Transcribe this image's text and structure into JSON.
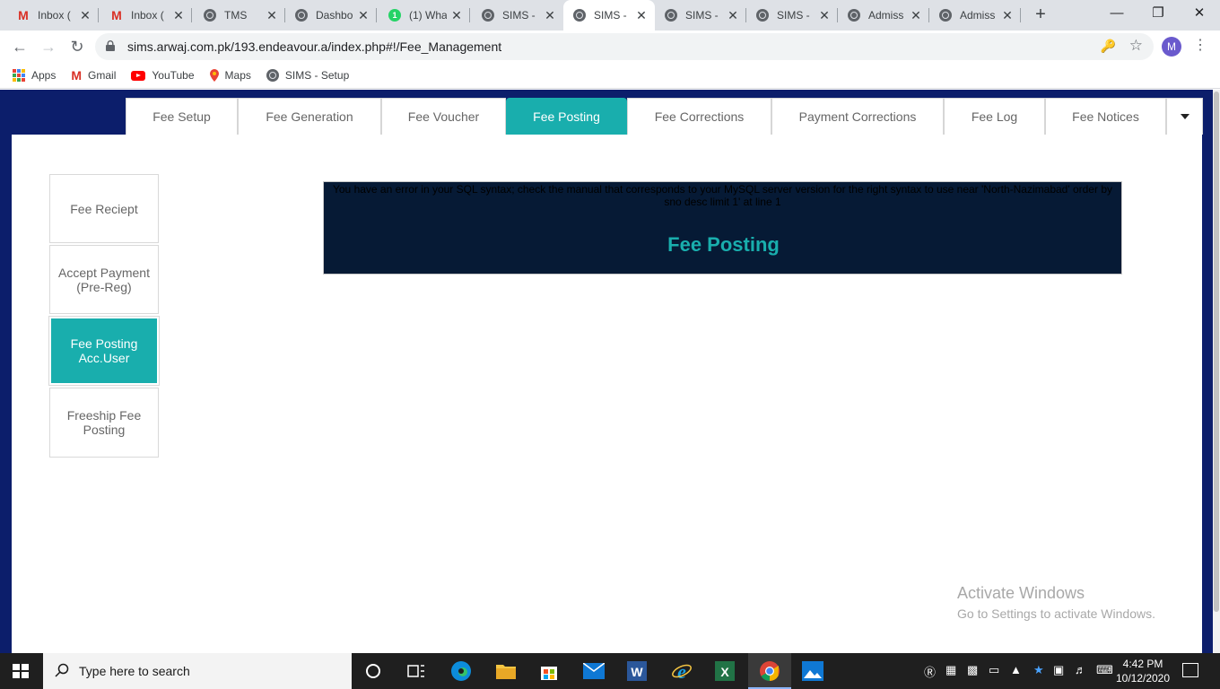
{
  "browser": {
    "tabs": [
      {
        "title": "Inbox (",
        "icon": "gmail-icon",
        "active": false
      },
      {
        "title": "Inbox (",
        "icon": "gmail-icon",
        "active": false
      },
      {
        "title": "TMS",
        "icon": "globe-icon",
        "active": false
      },
      {
        "title": "Dashbo",
        "icon": "globe-icon",
        "active": false
      },
      {
        "title": "(1) Wha",
        "icon": "whatsapp-icon",
        "active": false
      },
      {
        "title": "SIMS -",
        "icon": "globe-icon",
        "active": false
      },
      {
        "title": "SIMS -",
        "icon": "globe-icon",
        "active": true
      },
      {
        "title": "SIMS -",
        "icon": "globe-icon",
        "active": false
      },
      {
        "title": "SIMS -",
        "icon": "globe-icon",
        "active": false
      },
      {
        "title": "Admiss",
        "icon": "globe-icon",
        "active": false
      },
      {
        "title": "Admiss",
        "icon": "globe-icon",
        "active": false
      }
    ],
    "whatsapp_badge": "1",
    "url": "sims.arwaj.com.pk/193.endeavour.a/index.php#!/Fee_Management",
    "profile_initial": "M",
    "bookmarks": [
      {
        "label": "Apps",
        "icon": "apps-grid-icon"
      },
      {
        "label": "Gmail",
        "icon": "gmail-icon"
      },
      {
        "label": "YouTube",
        "icon": "youtube-icon"
      },
      {
        "label": "Maps",
        "icon": "maps-pin-icon"
      },
      {
        "label": "SIMS - Setup",
        "icon": "globe-icon"
      }
    ]
  },
  "fee_tabs": [
    {
      "label": "Fee Setup",
      "active": false
    },
    {
      "label": "Fee Generation",
      "active": false
    },
    {
      "label": "Fee Voucher",
      "active": false
    },
    {
      "label": "Fee Posting",
      "active": true
    },
    {
      "label": "Fee Corrections",
      "active": false
    },
    {
      "label": "Payment Corrections",
      "active": false
    },
    {
      "label": "Fee Log",
      "active": false
    },
    {
      "label": "Fee Notices",
      "active": false
    }
  ],
  "side_menu": [
    {
      "label": "Fee Reciept",
      "active": false
    },
    {
      "label": "Accept Payment (Pre-Reg)",
      "active": false
    },
    {
      "label": "Fee Posting Acc.User",
      "active": true
    },
    {
      "label": "Freeship Fee Posting",
      "active": false
    }
  ],
  "panel": {
    "error": "You have an error in your SQL syntax; check the manual that corresponds to your MySQL server version for the right syntax to use near 'North-Nazimabad' order by sno desc limit 1' at line 1",
    "title": "Fee Posting"
  },
  "watermark": {
    "heading": "Activate Windows",
    "sub": "Go to Settings to activate Windows."
  },
  "taskbar": {
    "search_placeholder": "Type here to search",
    "time": "4:42 PM",
    "date": "10/12/2020"
  },
  "colors": {
    "accent": "#19aead",
    "page_bg": "#0c1e6b",
    "panel_bg": "#061a35"
  }
}
